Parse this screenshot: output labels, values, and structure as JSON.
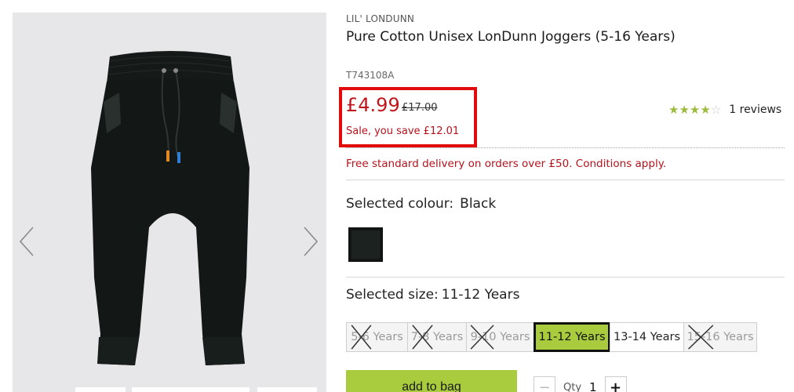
{
  "product": {
    "brand": "LIL' LONDUNN",
    "title": "Pure Cotton Unisex LonDunn Joggers (5-16 Years)",
    "sku": "T743108A",
    "image_alt": "Black joggers",
    "gallery": {
      "prev_icon": "chevron-left-icon",
      "next_icon": "chevron-right-icon"
    }
  },
  "pricing": {
    "now": "£4.99",
    "was": "£17.00",
    "saving": "Sale, you save £12.01",
    "highlight_color": "#e10b0b",
    "price_color": "#c0161d"
  },
  "rating": {
    "stars_filled": 4,
    "stars_total": 5,
    "review_text": "1 reviews",
    "star_color": "#9dbb3c"
  },
  "delivery": {
    "text": "Free standard delivery on orders over £50. Conditions apply."
  },
  "colour": {
    "label": "Selected colour:",
    "value": "Black",
    "swatch_color": "#121715"
  },
  "size": {
    "label": "Selected size:",
    "value": "11-12 Years",
    "options": [
      {
        "label": "5-6 Years",
        "state": "unavailable"
      },
      {
        "label": "7-8 Years",
        "state": "unavailable"
      },
      {
        "label": "9-10 Years",
        "state": "unavailable"
      },
      {
        "label": "11-12 Years",
        "state": "selected"
      },
      {
        "label": "13-14 Years",
        "state": "available"
      },
      {
        "label": "15-16 Years",
        "state": "unavailable"
      }
    ],
    "selected_color": "#a9cc3e"
  },
  "cart": {
    "add_label": "add to bag",
    "qty_label": "Qty",
    "qty_value": "1",
    "minus_symbol": "−",
    "plus_symbol": "+",
    "button_color": "#a9cc3e"
  }
}
